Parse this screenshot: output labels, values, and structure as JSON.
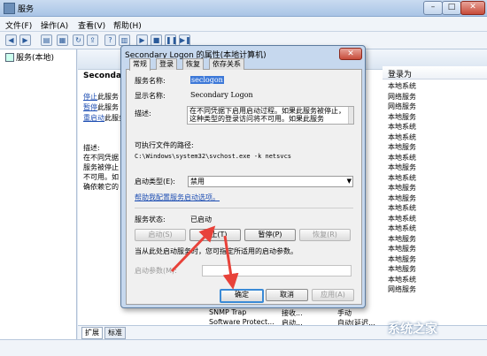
{
  "window": {
    "title": "服务",
    "min": "–",
    "max": "□",
    "close": "✕"
  },
  "menu": [
    "文件(F)",
    "操作(A)",
    "查看(V)",
    "帮助(H)"
  ],
  "tree": {
    "root": "服务(本地)"
  },
  "main": {
    "selected_name": "Secondary",
    "actions": [
      "停止",
      "此服务",
      "暂停",
      "此服务",
      "重启动",
      "此服务"
    ],
    "desc_lines": [
      "描述:",
      "在不同凭据",
      "服务被停止",
      "不可用。如",
      "确依赖它的"
    ],
    "col_header": "登录为",
    "logon_values": [
      "本地系统",
      "网络服务",
      "网络服务",
      "本地服务",
      "本地系统",
      "本地系统",
      "本地服务",
      "本地系统",
      "本地服务",
      "本地系统",
      "本地服务",
      "本地服务",
      "本地系统",
      "本地系统",
      "本地系统",
      "本地服务",
      "本地服务",
      "本地服务",
      "本地服务",
      "本地系统",
      "网络服务"
    ],
    "partial_rows": [
      {
        "name": "SNMP Trap",
        "status": "接收...",
        "type": "手动",
        "logon": "本地服务"
      },
      {
        "name": "Software Protect...",
        "status": "启动...",
        "type": "自动(延迟...",
        "logon": "网络服务"
      }
    ]
  },
  "bottom_tabs": [
    "扩展",
    "标准"
  ],
  "dialog": {
    "title": "Secondary Logon 的属性(本地计算机)",
    "close": "✕",
    "tabs": [
      "常规",
      "登录",
      "恢复",
      "依存关系"
    ],
    "service_name_label": "服务名称:",
    "service_name": "seclogon",
    "display_name_label": "显示名称:",
    "display_name": "Secondary Logon",
    "description_label": "描述:",
    "description": "在不同凭据下启用启动过程。如果此服务被停止，这种类型的登录访问将不可用。如果此服务",
    "path_label": "可执行文件的路径:",
    "path": "C:\\Windows\\system32\\svchost.exe -k netsvcs",
    "startup_type_label": "启动类型(E):",
    "startup_type": "禁用",
    "help_link": "帮助我配置服务启动选项。",
    "status_label": "服务状态:",
    "status_value": "已启动",
    "buttons": {
      "start": "启动(S)",
      "stop": "停止(T)",
      "pause": "暂停(P)",
      "resume": "恢复(R)"
    },
    "hint": "当从此处启动服务时，您可指定所适用的启动参数。",
    "start_params_label": "启动参数(M):",
    "start_params_value": "",
    "ok": "确定",
    "cancel": "取消",
    "apply": "应用(A)"
  },
  "watermark": "系统之家",
  "colors": {
    "accent": "#3c78d8",
    "arrow": "#e8423a"
  }
}
